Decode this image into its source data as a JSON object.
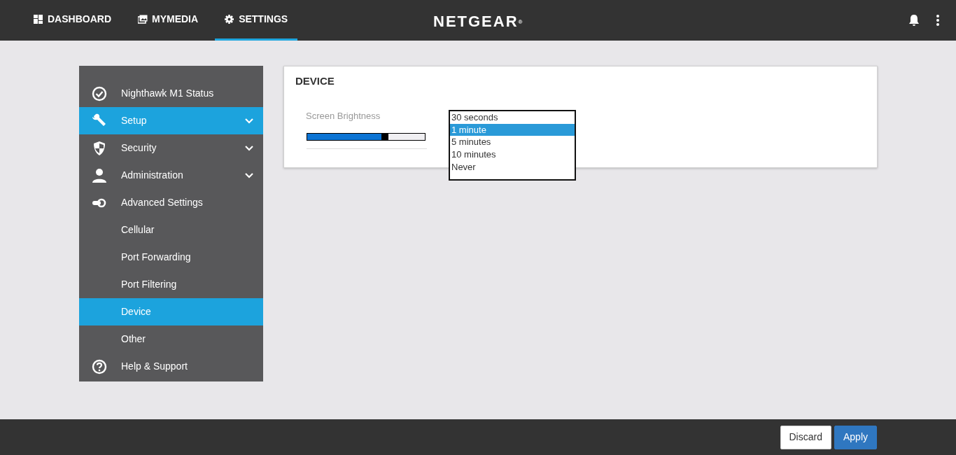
{
  "topnav": {
    "tabs": [
      {
        "label": "DASHBOARD",
        "selected": false
      },
      {
        "label": "MYMEDIA",
        "selected": false
      },
      {
        "label": "SETTINGS",
        "selected": true
      }
    ],
    "logo": "NETGEAR",
    "logo_mark": "®"
  },
  "sidebar": {
    "items": [
      {
        "label": "Nighthawk M1 Status",
        "kind": "main",
        "selected": false,
        "has_submenu": false
      },
      {
        "label": "Setup",
        "kind": "main",
        "selected": true,
        "has_submenu": true
      },
      {
        "label": "Security",
        "kind": "main",
        "selected": false,
        "has_submenu": true
      },
      {
        "label": "Administration",
        "kind": "main",
        "selected": false,
        "has_submenu": true
      },
      {
        "label": "Advanced Settings",
        "kind": "main",
        "selected": false,
        "has_submenu": false
      },
      {
        "label": "Cellular",
        "kind": "sub",
        "selected": false,
        "has_submenu": false
      },
      {
        "label": "Port Forwarding",
        "kind": "sub",
        "selected": false,
        "has_submenu": false
      },
      {
        "label": "Port Filtering",
        "kind": "sub",
        "selected": false,
        "has_submenu": false
      },
      {
        "label": "Device",
        "kind": "sub",
        "selected": true,
        "has_submenu": false
      },
      {
        "label": "Other",
        "kind": "sub",
        "selected": false,
        "has_submenu": false
      },
      {
        "label": "Help & Support",
        "kind": "main",
        "selected": false,
        "has_submenu": false
      }
    ]
  },
  "panel": {
    "title": "DEVICE",
    "brightness": {
      "label": "Screen Brightness",
      "level": 0.66
    },
    "timeout_options": [
      {
        "label": "30 seconds",
        "selected": false
      },
      {
        "label": "1 minute",
        "selected": true
      },
      {
        "label": "5 minutes",
        "selected": false
      },
      {
        "label": "10 minutes",
        "selected": false
      },
      {
        "label": "Never",
        "selected": false
      }
    ]
  },
  "footer": {
    "buttons": [
      {
        "label": "Discard",
        "kind": "secondary"
      },
      {
        "label": "Apply",
        "kind": "primary"
      }
    ]
  }
}
